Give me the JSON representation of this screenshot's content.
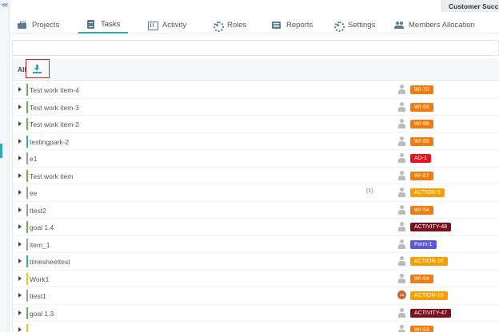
{
  "left_strip": {
    "collapse_icon": "double-chevron-left-icon",
    "collapse_label": "<<"
  },
  "header": {
    "customer_label": "Customer Succ"
  },
  "tabs": [
    {
      "label": "Projects",
      "icon": "briefcase-icon",
      "active": false
    },
    {
      "label": "Tasks",
      "icon": "tasks-icon",
      "active": true
    },
    {
      "label": "Activity",
      "icon": "activity-icon",
      "active": false
    },
    {
      "label": "Roles",
      "icon": "gear-icon",
      "active": false
    },
    {
      "label": "Reports",
      "icon": "list-icon",
      "active": false
    },
    {
      "label": "Settings",
      "icon": "gear-icon",
      "active": false
    },
    {
      "label": "Members Allocation",
      "icon": "users-icon",
      "active": false
    }
  ],
  "search": {
    "placeholder": ""
  },
  "table": {
    "group_label": "All",
    "download_icon": "download-icon",
    "rows": [
      {
        "title": "Test work item-4",
        "count": "",
        "tag": "WI-70",
        "tag_color": "#f07c10",
        "bar_color": "#67b64e",
        "avatar": "user-icon",
        "avatar_text": ""
      },
      {
        "title": "Test work item-3",
        "count": "",
        "tag": "WI-66",
        "tag_color": "#f07c10",
        "bar_color": "#67b64e",
        "avatar": "user-icon",
        "avatar_text": ""
      },
      {
        "title": "Test work item-2",
        "count": "",
        "tag": "WI-66",
        "tag_color": "#f07c10",
        "bar_color": "#67b64e",
        "avatar": "user-icon",
        "avatar_text": ""
      },
      {
        "title": "testingpark-2",
        "count": "",
        "tag": "WI-66",
        "tag_color": "#f07c10",
        "bar_color": "#34a6d6",
        "avatar": "user-icon",
        "avatar_text": ""
      },
      {
        "title": "e1",
        "count": "",
        "tag": "AD-1",
        "tag_color": "#e8131f",
        "bar_color": "#9aa0a6",
        "avatar": "user-icon",
        "avatar_text": ""
      },
      {
        "title": "Test work item",
        "count": "",
        "tag": "WI-67",
        "tag_color": "#f07c10",
        "bar_color": "#67b64e",
        "avatar": "user-icon",
        "avatar_text": ""
      },
      {
        "title": "ee",
        "count": "(1)",
        "tag": "ACTION-9",
        "tag_color": "#f5a000",
        "bar_color": "#9aa0a6",
        "avatar": "user-icon",
        "avatar_text": ""
      },
      {
        "title": "ttest2",
        "count": "",
        "tag": "WI-54",
        "tag_color": "#f07c10",
        "bar_color": "#9aa0a6",
        "avatar": "user-icon",
        "avatar_text": ""
      },
      {
        "title": "goal 1.4",
        "count": "",
        "tag": "ACTIVITY-48",
        "tag_color": "#7a0f1b",
        "bar_color": "#67b64e",
        "avatar": "user-icon",
        "avatar_text": ""
      },
      {
        "title": "item_1",
        "count": "",
        "tag": "Form-1",
        "tag_color": "#5b5bd6",
        "bar_color": "#9aa0a6",
        "avatar": "user-icon",
        "avatar_text": ""
      },
      {
        "title": "timesheettest",
        "count": "",
        "tag": "ACTION-18",
        "tag_color": "#f5a000",
        "bar_color": "#34a6d6",
        "avatar": "user-icon",
        "avatar_text": ""
      },
      {
        "title": "Work1",
        "count": "",
        "tag": "WI-64",
        "tag_color": "#f07c10",
        "bar_color": "#f5c518",
        "avatar": "user-icon",
        "avatar_text": ""
      },
      {
        "title": "ttest1",
        "count": "",
        "tag": "ACTION-19",
        "tag_color": "#f5a000",
        "bar_color": "#9aa0a6",
        "avatar": "avatar-badge",
        "avatar_text": "UB"
      },
      {
        "title": "goal 1.3",
        "count": "",
        "tag": "ACTIVITY-47",
        "tag_color": "#7a0f1b",
        "bar_color": "#67b64e",
        "avatar": "user-icon",
        "avatar_text": ""
      },
      {
        "title": "",
        "count": "",
        "tag": "WI-63",
        "tag_color": "#f07c10",
        "bar_color": "#f5c518",
        "avatar": "user-icon",
        "avatar_text": ""
      }
    ]
  }
}
